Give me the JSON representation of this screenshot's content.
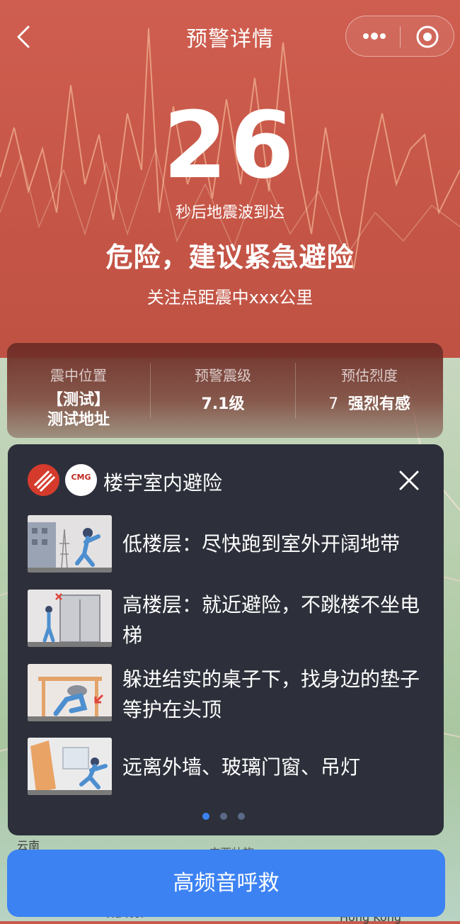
{
  "nav": {
    "title": "预警详情"
  },
  "countdown": {
    "seconds": "26",
    "subtitle": "秒后地震波到达"
  },
  "alert": {
    "level_text": "危险，建议紧急避险",
    "distance_text": "关注点距震中xxx公里"
  },
  "info": {
    "epicenter": {
      "label": "震中位置",
      "value_line1": "【测试】",
      "value_line2": "测试地址"
    },
    "magnitude": {
      "label": "预警震级",
      "value": "7.1级"
    },
    "intensity": {
      "label": "预估烈度",
      "number": "7",
      "desc": "强烈有感"
    }
  },
  "guide": {
    "logo_text": "CMG",
    "title": "楼宇室内避险",
    "items": [
      {
        "text": "低楼层：尽快跑到室外开阔地带"
      },
      {
        "text": "高楼层：就近避险，不跳楼不坐电梯"
      },
      {
        "text": "躲进结实的桌子下，找身边的垫子等护在头顶"
      },
      {
        "text": "远离外墙、玻璃门窗、吊灯"
      }
    ],
    "page_index": 1,
    "page_count": 3
  },
  "map_labels": {
    "label1": "云南",
    "label2": "广西壮族",
    "label3": "Ha Noi",
    "label4": "Hong Kong"
  },
  "sos_button": {
    "label": "高频音呼救"
  },
  "colors": {
    "banner": "#c85a4c",
    "panel": "#2d303a",
    "button": "#3c82f3"
  }
}
